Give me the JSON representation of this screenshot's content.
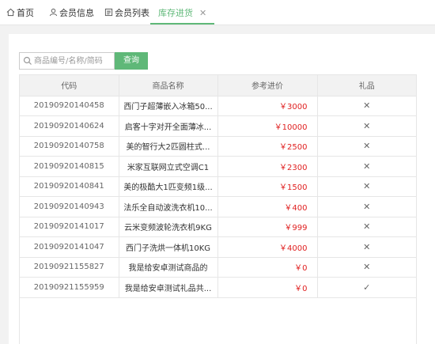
{
  "tabs": [
    {
      "label": "首页",
      "icon": "home-icon"
    },
    {
      "label": "会员信息",
      "icon": "user-icon"
    },
    {
      "label": "会员列表",
      "icon": "list-icon"
    },
    {
      "label": "库存进货",
      "icon": null,
      "close": "✕"
    }
  ],
  "search": {
    "placeholder": "商品编号/名称/简码",
    "value": "",
    "button_label": "查询"
  },
  "table": {
    "headers": [
      "代码",
      "商品名称",
      "参考进价",
      "礼品"
    ],
    "rows": [
      {
        "code": "20190920140458",
        "name": "西门子超薄嵌入冰箱50...",
        "price": "￥3000",
        "gift": "✕"
      },
      {
        "code": "20190920140624",
        "name": "启客十字对开全面薄冰...",
        "price": "￥10000",
        "gift": "✕"
      },
      {
        "code": "20190920140758",
        "name": "美的智行大2匹圆柱式...",
        "price": "￥2500",
        "gift": "✕"
      },
      {
        "code": "20190920140815",
        "name": "米家互联网立式空调C1",
        "price": "￥2300",
        "gift": "✕"
      },
      {
        "code": "20190920140841",
        "name": "美的极酷大1匹变频1级...",
        "price": "￥1500",
        "gift": "✕"
      },
      {
        "code": "20190920140943",
        "name": "法乐全自动波洗衣机10...",
        "price": "￥400",
        "gift": "✕"
      },
      {
        "code": "20190920141017",
        "name": "云米变频波轮洗衣机9KG",
        "price": "￥999",
        "gift": "✕"
      },
      {
        "code": "20190920141047",
        "name": "西门子洗烘一体机10KG",
        "price": "￥4000",
        "gift": "✕"
      },
      {
        "code": "20190921155827",
        "name": "我是给安卓测试商品的",
        "price": "￥0",
        "gift": "✕"
      },
      {
        "code": "20190921155959",
        "name": "我是给安卓测试礼品共...",
        "price": "￥0",
        "gift": "✓"
      }
    ]
  },
  "colors": {
    "accent": "#5fb878",
    "price": "#e02020"
  }
}
